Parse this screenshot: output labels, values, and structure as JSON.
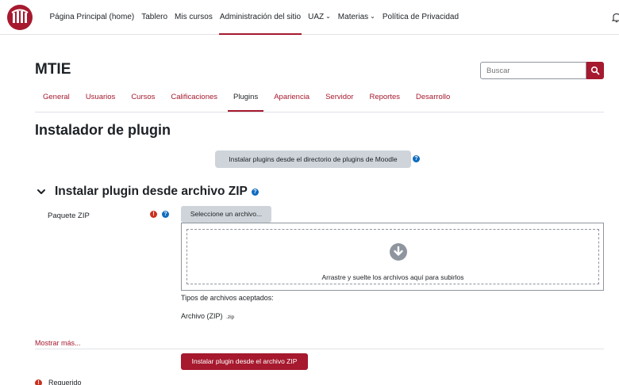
{
  "topnav": {
    "items": [
      {
        "label": "Página Principal (home)",
        "active": false,
        "dropdown": false
      },
      {
        "label": "Tablero",
        "active": false,
        "dropdown": false
      },
      {
        "label": "Mis cursos",
        "active": false,
        "dropdown": false
      },
      {
        "label": "Administración del sitio",
        "active": true,
        "dropdown": false
      },
      {
        "label": "UAZ",
        "active": false,
        "dropdown": true
      },
      {
        "label": "Materias",
        "active": false,
        "dropdown": true
      },
      {
        "label": "Política de Privacidad",
        "active": false,
        "dropdown": false
      }
    ]
  },
  "header": {
    "site_title": "MTIE",
    "search_placeholder": "Buscar"
  },
  "subnav": {
    "items": [
      {
        "label": "General",
        "active": false
      },
      {
        "label": "Usuarios",
        "active": false
      },
      {
        "label": "Cursos",
        "active": false
      },
      {
        "label": "Calificaciones",
        "active": false
      },
      {
        "label": "Plugins",
        "active": true
      },
      {
        "label": "Apariencia",
        "active": false
      },
      {
        "label": "Servidor",
        "active": false
      },
      {
        "label": "Reportes",
        "active": false
      },
      {
        "label": "Desarrollo",
        "active": false
      }
    ]
  },
  "main": {
    "page_title": "Instalador de plugin",
    "directory_button": "Instalar plugins desde el directorio de plugins de Moodle",
    "section_title": "Instalar plugin desde archivo ZIP",
    "zip_label": "Paquete ZIP",
    "choose_button": "Seleccione un archivo...",
    "dropzone_text": "Arrastre y suelte los archivos aquí para subirlos",
    "accepted_types_label": "Tipos de archivos aceptados:",
    "accepted_type_name": "Archivo (ZIP)",
    "accepted_type_ext": ".zip",
    "show_more": "Mostrar más...",
    "install_button": "Instalar plugin desde el archivo ZIP",
    "required_legend": "Requerido"
  },
  "colors": {
    "brand": "#a6192e",
    "help": "#0f6cbf",
    "required": "#ca3120"
  },
  "icons": {
    "logo": "university-logo-icon",
    "bell": "bell-icon",
    "search": "search-icon",
    "help": "question-circle-icon",
    "required": "exclamation-circle-icon",
    "chevron": "chevron-down-icon",
    "upload": "download-arrow-circle-icon"
  }
}
